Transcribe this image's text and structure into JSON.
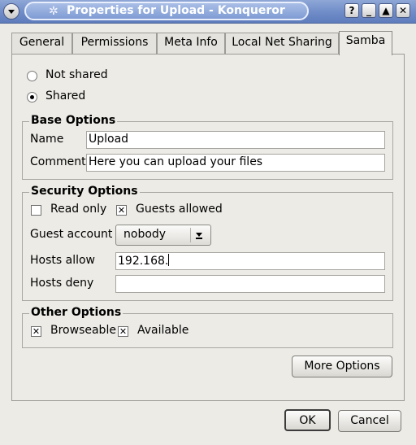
{
  "window": {
    "title": "Properties for Upload - Konqueror",
    "buttons": [
      "?",
      "_",
      "▲",
      "✕"
    ]
  },
  "tabs": [
    {
      "label": "General",
      "accel": "G"
    },
    {
      "label": "Permissions",
      "accel": "P"
    },
    {
      "label": "Meta Info",
      "accel": "M"
    },
    {
      "label": "Local Net Sharing",
      "accel": ""
    },
    {
      "label": "Samba",
      "accel": "b",
      "active": true
    }
  ],
  "sharing": {
    "not_shared": "Not shared",
    "shared": "Shared",
    "selected": "shared"
  },
  "base_options": {
    "title": "Base Options",
    "name_label": "Name",
    "name_value": "Upload",
    "comment_label": "Comment",
    "comment_value": "Here you can upload your files"
  },
  "security_options": {
    "title": "Security Options",
    "read_only": {
      "label": "Read only",
      "checked": false
    },
    "guests_allowed": {
      "label": "Guests allowed",
      "checked": true
    },
    "guest_account_label": "Guest account",
    "guest_account_value": "nobody",
    "hosts_allow_label": "Hosts allow",
    "hosts_allow_value": "192.168.",
    "hosts_deny_label": "Hosts deny",
    "hosts_deny_value": ""
  },
  "other_options": {
    "title": "Other Options",
    "browseable": {
      "label": "Browseable",
      "checked": true
    },
    "available": {
      "label": "Available",
      "checked": true
    }
  },
  "buttons": {
    "more_options": "More Options",
    "ok": "OK",
    "cancel": "Cancel"
  },
  "colors": {
    "titlebar": "#6f8cc8",
    "background": "#ecebe6"
  }
}
